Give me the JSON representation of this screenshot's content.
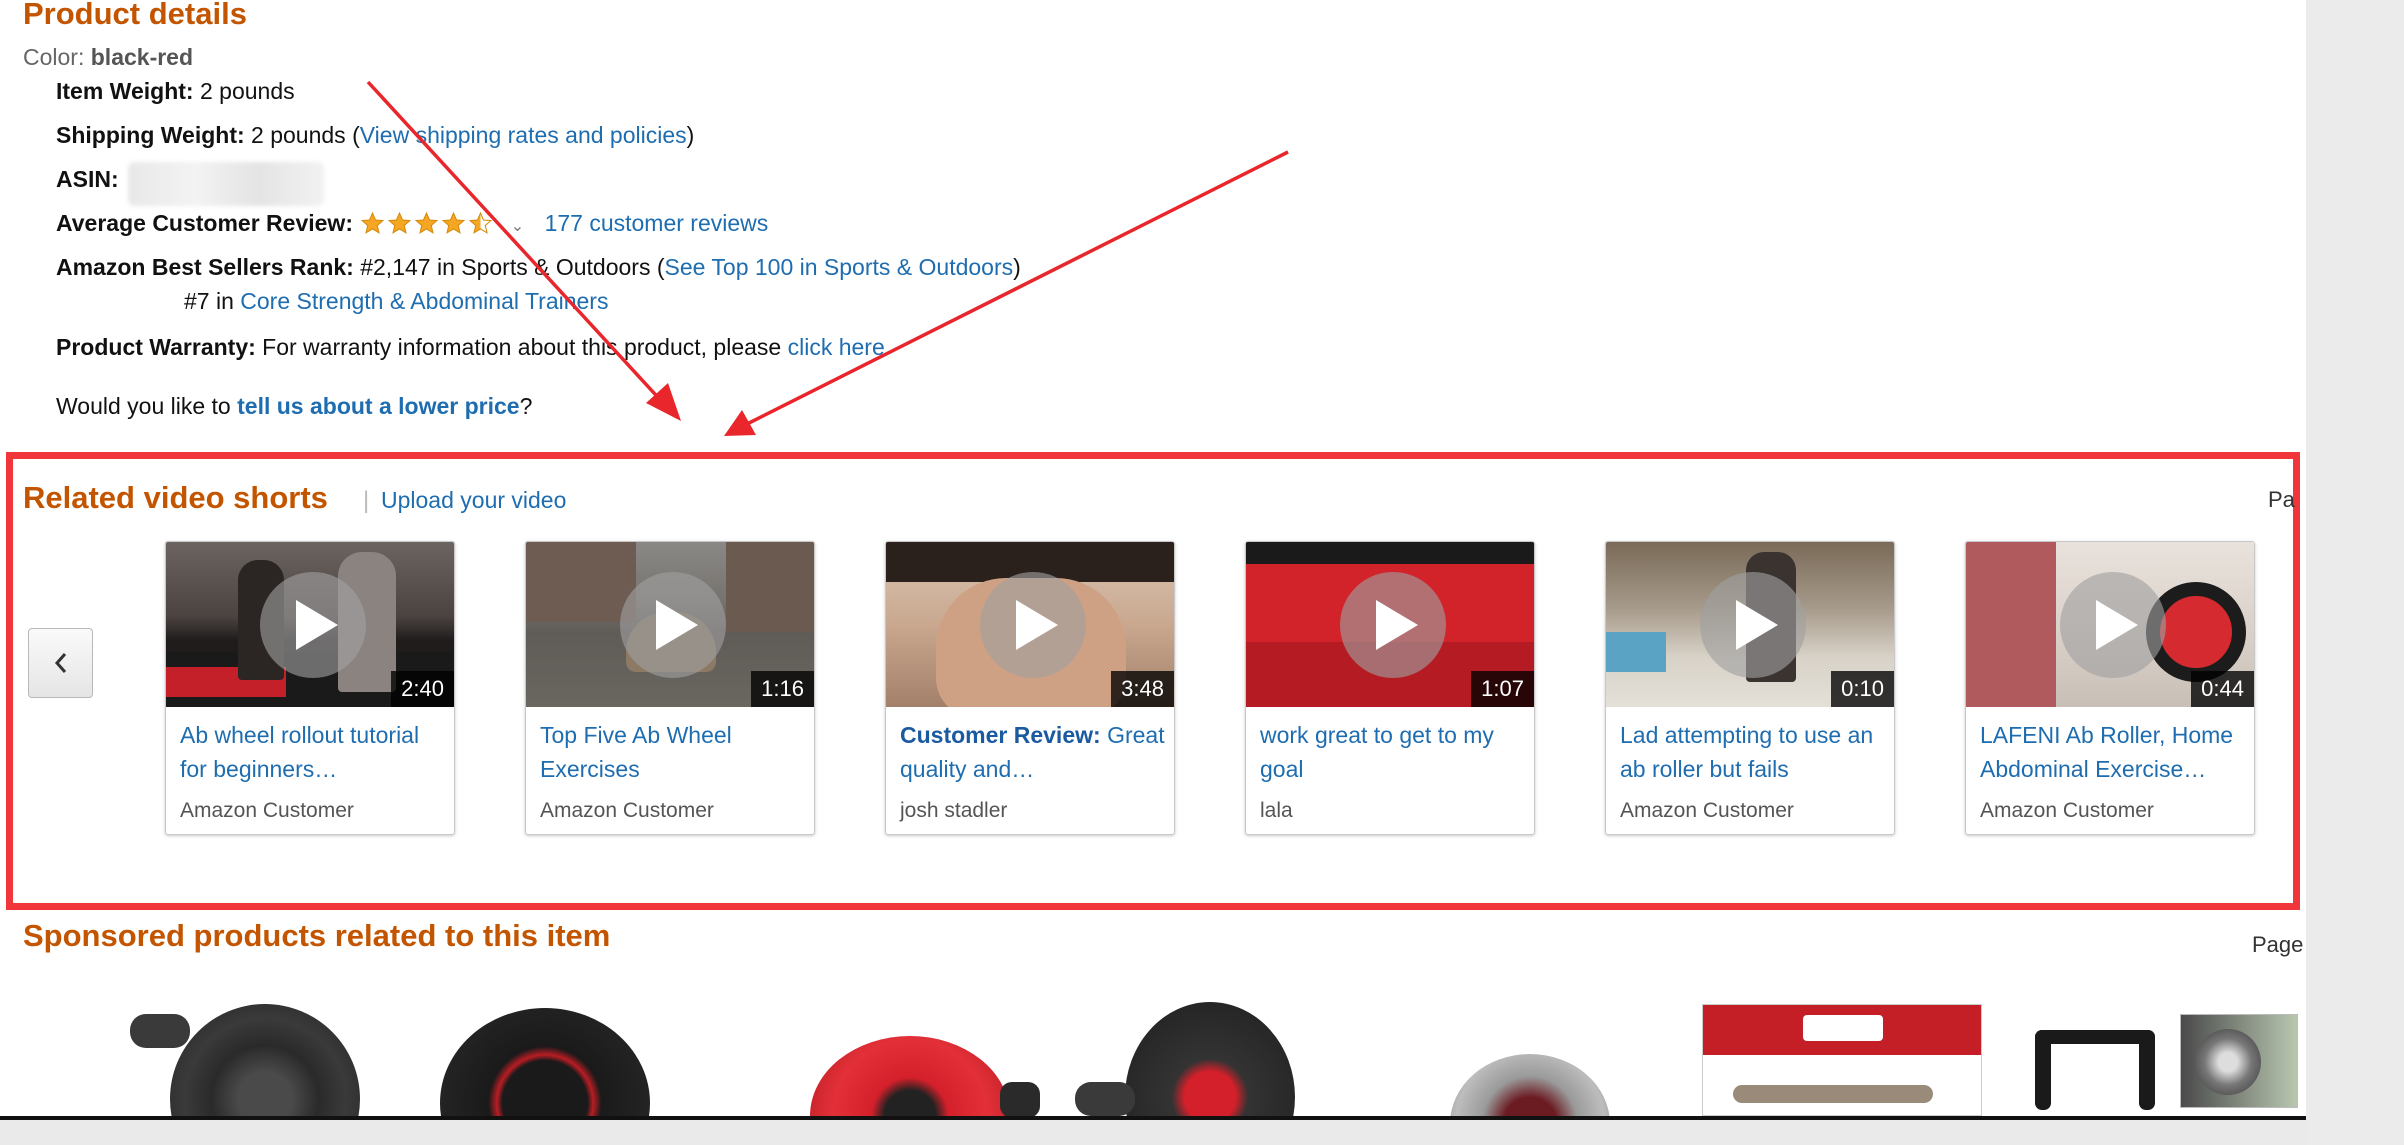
{
  "product_details": {
    "title": "Product details",
    "color_label": "Color:",
    "color_value": "black-red",
    "item_weight_label": "Item Weight:",
    "item_weight_value": "2 pounds",
    "shipping_weight_label": "Shipping Weight:",
    "shipping_weight_value": "2 pounds (",
    "shipping_link": "View shipping rates and policies",
    "shipping_close": ")",
    "asin_label": "ASIN:",
    "avg_review_label": "Average Customer Review:",
    "review_stars": 4.5,
    "review_link": "177 customer reviews",
    "rank_label": "Amazon Best Sellers Rank:",
    "rank_value": "#2,147 in Sports & Outdoors (",
    "rank_link": "See Top 100 in Sports & Outdoors",
    "rank_close": ")",
    "subrank_prefix": "#7 in",
    "subrank_link": "Core Strength & Abdominal Trainers",
    "warranty_label": "Product Warranty:",
    "warranty_text": "For warranty information about this product, please",
    "warranty_link": "click here",
    "lower_price_prefix": "Would you like to",
    "lower_price_link": "tell us about a lower price",
    "lower_price_suffix": "?"
  },
  "related_videos": {
    "title": "Related video shorts",
    "separator": "|",
    "upload_link": "Upload your video",
    "page_label": "Pa",
    "videos": [
      {
        "duration": "2:40",
        "title": "Ab wheel rollout tutorial for beginners…",
        "author": "Amazon Customer"
      },
      {
        "duration": "1:16",
        "title": "Top Five Ab Wheel Exercises",
        "author": "Amazon Customer"
      },
      {
        "duration": "3:48",
        "title_prefix": "Customer Review:",
        "title": "Great quality and…",
        "author": "josh stadler"
      },
      {
        "duration": "1:07",
        "title": "work great to get to my goal",
        "author": "lala"
      },
      {
        "duration": "0:10",
        "title": "Lad attempting to use an ab roller but fails",
        "author": "Amazon Customer"
      },
      {
        "duration": "0:44",
        "title": "LAFENI Ab Roller, Home Abdominal Exercise…",
        "author": "Amazon Customer"
      }
    ]
  },
  "sponsored": {
    "title": "Sponsored products related to this item",
    "page_label": "Page"
  },
  "colors": {
    "heading_orange": "#c45500",
    "link_blue": "#1e6db0",
    "highlight_red": "#f0353b",
    "arrow_red": "#e8262c"
  }
}
